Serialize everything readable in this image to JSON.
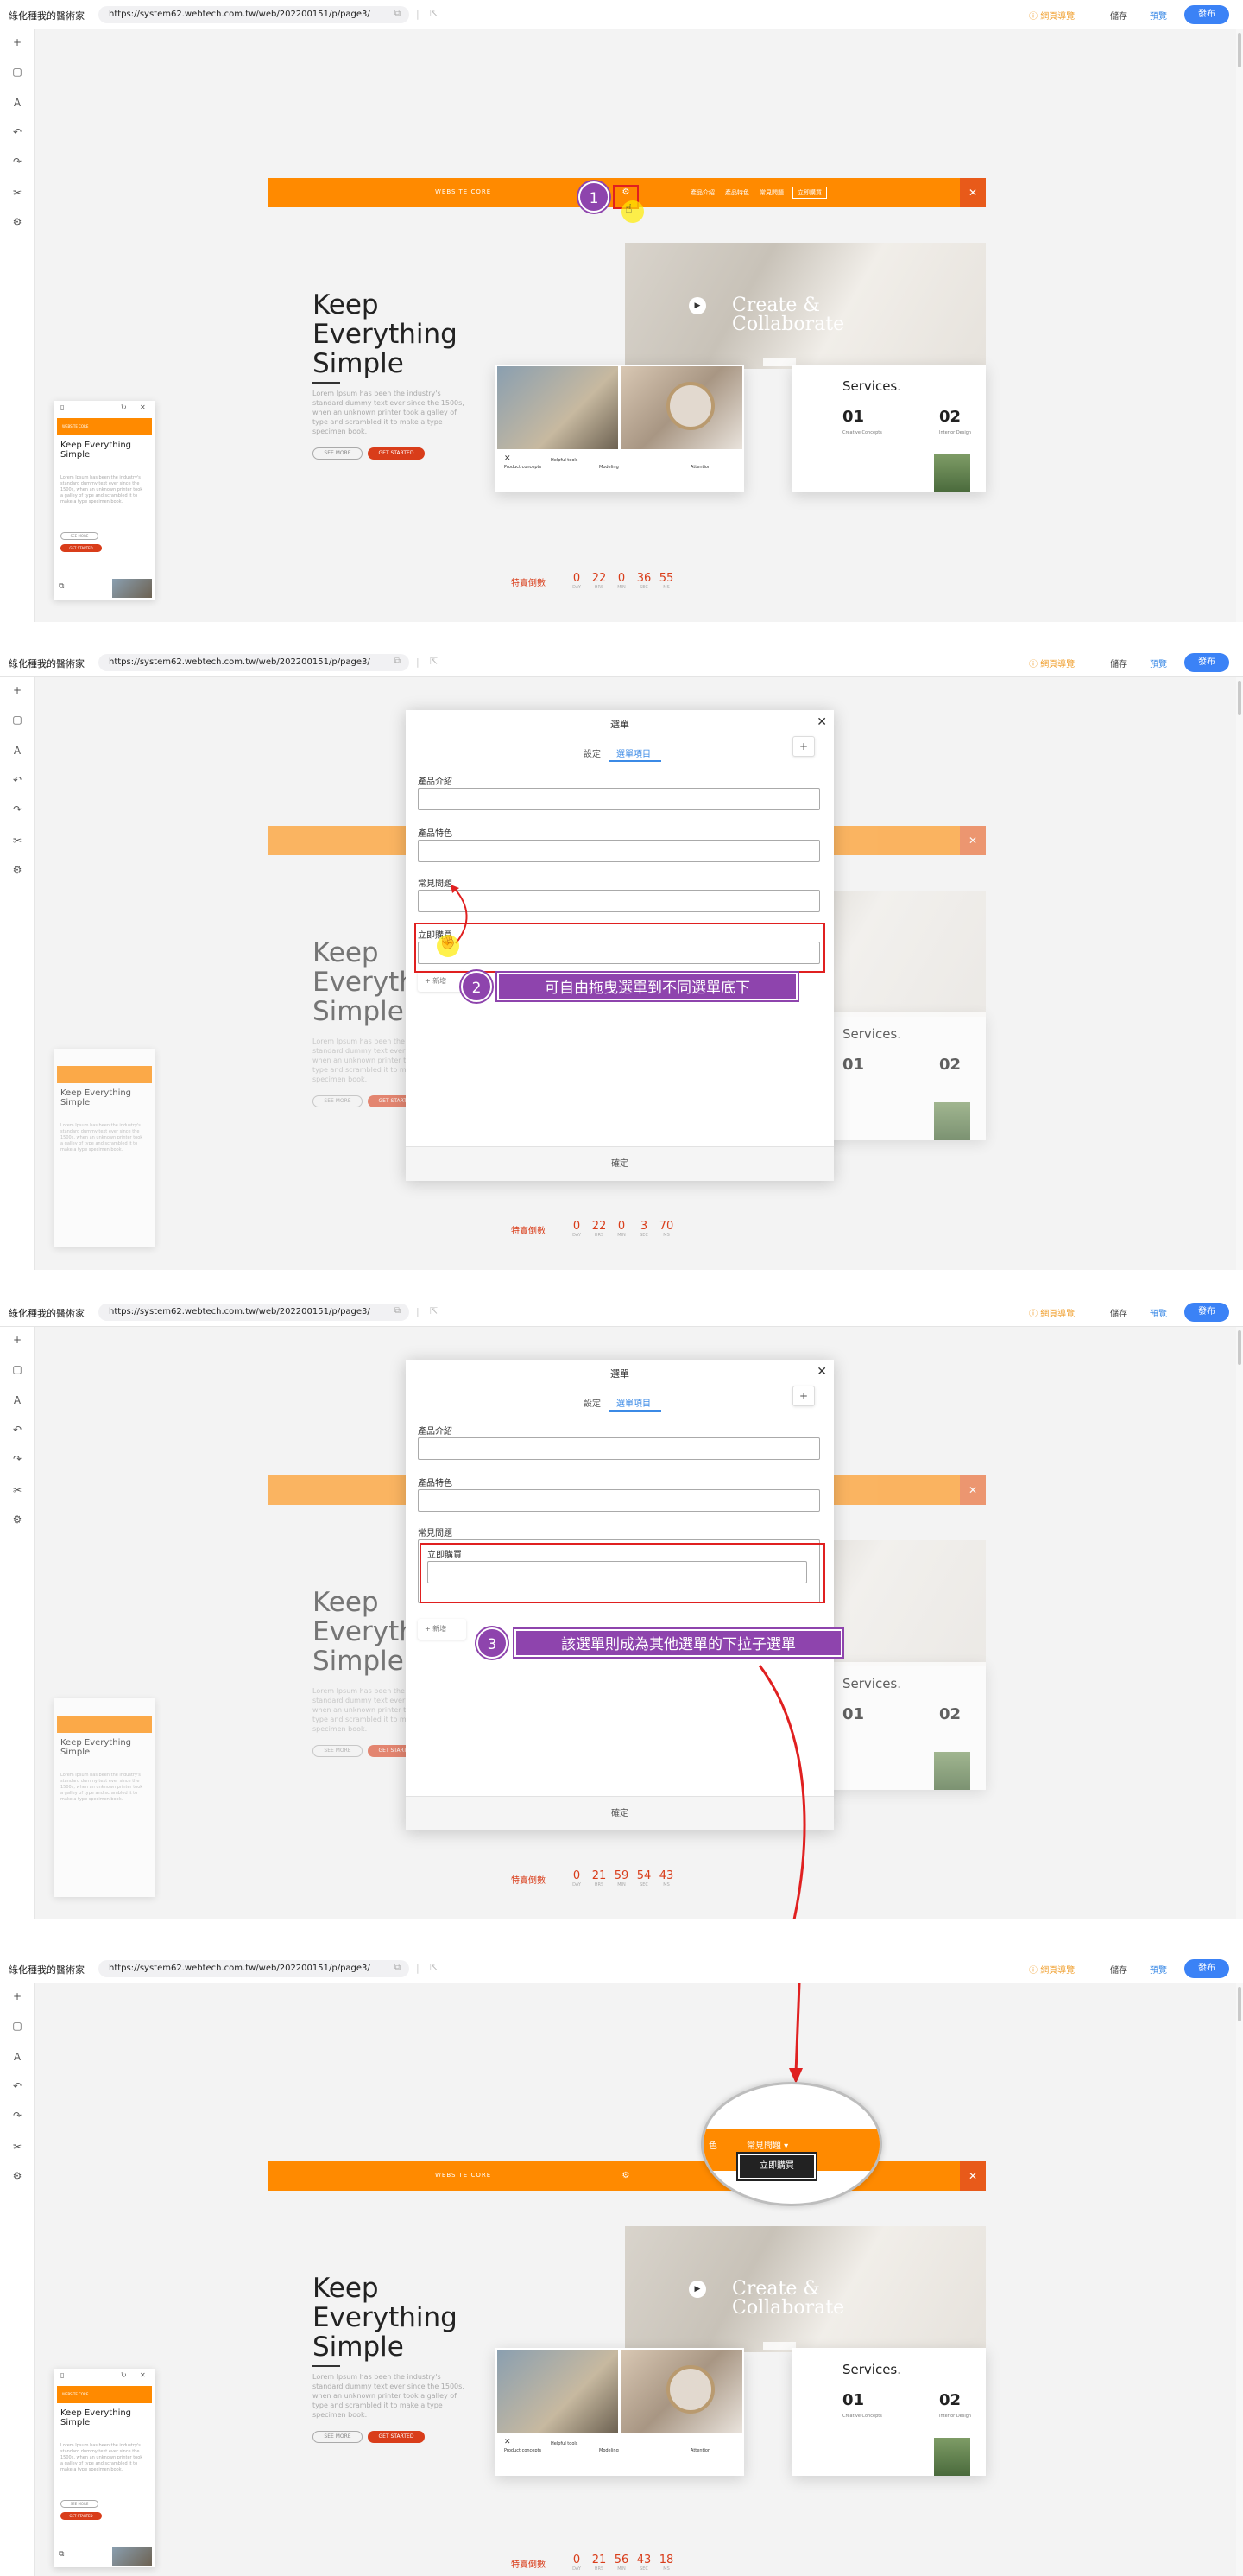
{
  "browser": {
    "site_title": "綠化種我的醫術家",
    "url": "https://system62.webtech.com.tw/web/202200151/p/page3/",
    "separator": "|",
    "guided_tour": "網頁導覽",
    "save": "儲存",
    "preview": "預覽",
    "publish": "發布"
  },
  "sidebar_icons": [
    "plus-icon",
    "layers-icon",
    "text-icon",
    "undo-icon",
    "redo-icon",
    "tools-icon",
    "settings-icon"
  ],
  "site": {
    "brand": "WEBSITE CORE",
    "nav": [
      "產品介紹",
      "產品特色",
      "常見問題"
    ],
    "nav_cta": "立即購買",
    "hero_title_1": "Keep",
    "hero_title_2": "Everything",
    "hero_title_3": "Simple",
    "hero_desc": "Lorem Ipsum has been the industry's standard dummy text ever since the 1500s, when an unknown printer took a galley of type and scrambled it to make a type specimen book.",
    "btn_more": "SEE MORE",
    "btn_start": "GET STARTED",
    "create_title_1": "Create &",
    "create_title_2": "Collaborate",
    "services": "Services.",
    "svc_01": "01",
    "svc_02": "02",
    "svc_01_sub": "Creative Concepts",
    "svc_02_sub": "Interior Design",
    "card_t1": "Product concepts",
    "card_t2": "Helpful tools",
    "card_t3": "Modeling",
    "card_t4": "Attention",
    "mobile_title": "Keep Everything Simple",
    "mobile_desc": "Lorem Ipsum has been the industry's standard dummy text ever since the 1500s, when an unknown printer took a galley of type and scrambled it to make a type specimen book."
  },
  "countdown_label": "特賣倒數",
  "countdown_units": [
    "DAY",
    "HRS",
    "MIN",
    "SEC",
    "MS"
  ],
  "countdowns": [
    [
      "0",
      "22",
      "0",
      "36",
      "55"
    ],
    [
      "0",
      "22",
      "0",
      "3",
      "70"
    ],
    [
      "0",
      "21",
      "59",
      "54",
      "43"
    ],
    [
      "0",
      "21",
      "56",
      "43",
      "18"
    ]
  ],
  "modal": {
    "title": "選單",
    "tab_settings": "設定",
    "tab_items": "選單項目",
    "plus": "+",
    "field_1": "產品介紹",
    "field_2": "產品特色",
    "field_3": "常見問題",
    "field_4": "立即購買",
    "add": "+ 新增",
    "confirm": "確定"
  },
  "steps": [
    {
      "num": "1"
    },
    {
      "num": "2",
      "text": "可自由拖曳選單到不同選單底下"
    },
    {
      "num": "3",
      "text": "該選單則成為其他選單的下拉子選單"
    }
  ],
  "magnifier": {
    "left": "色",
    "dropdown": "常見問題 ▾",
    "submenu": "立即購買"
  },
  "colors": {
    "accent_orange": "#ff8a00",
    "cta_red": "#d93d1a",
    "step_purple": "#8e44ad",
    "publish_blue": "#3b82f6",
    "highlight_red": "#e02020"
  }
}
